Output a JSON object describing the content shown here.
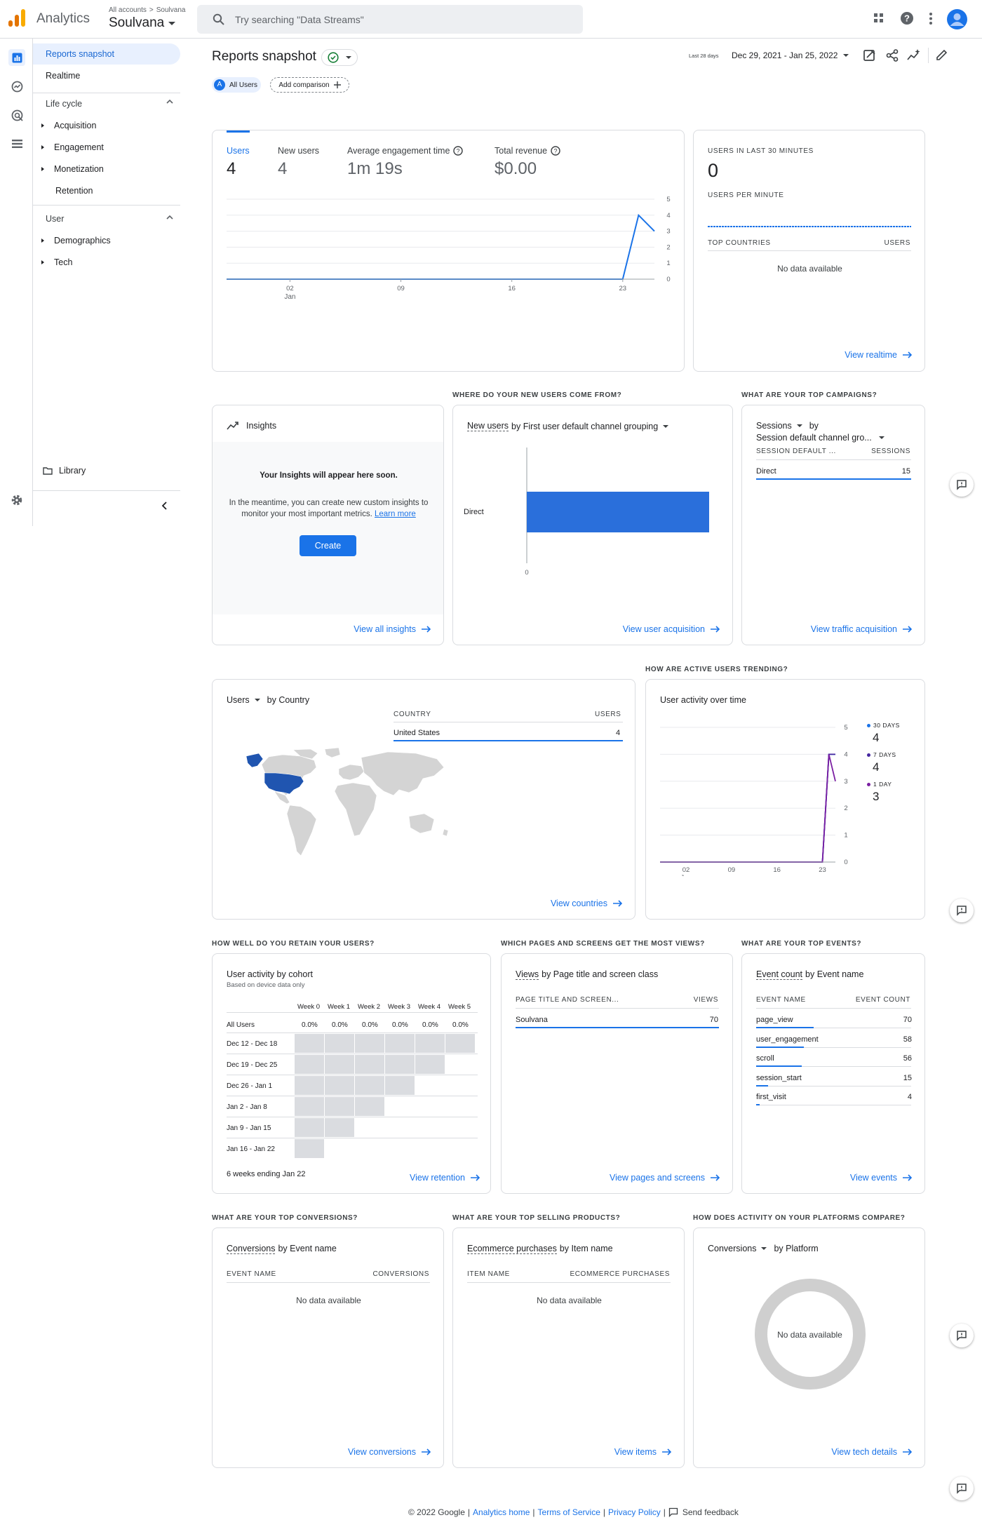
{
  "app": {
    "name": "Analytics",
    "breadcrumb_all": "All accounts",
    "breadcrumb_sep": ">",
    "breadcrumb_account": "Soulvana",
    "property": "Soulvana"
  },
  "search": {
    "placeholder": "Try searching \"Data Streams\""
  },
  "nav": {
    "items": [
      {
        "label": "Reports snapshot"
      },
      {
        "label": "Realtime"
      }
    ],
    "lifecycle": {
      "title": "Life cycle",
      "items": [
        "Acquisition",
        "Engagement",
        "Monetization",
        "Retention"
      ]
    },
    "user": {
      "title": "User",
      "items": [
        "Demographics",
        "Tech"
      ]
    },
    "library": "Library"
  },
  "header": {
    "title": "Reports snapshot",
    "date_label": "Last 28 days",
    "date_range": "Dec 29, 2021 - Jan 25, 2022",
    "all_users_badge": "A",
    "all_users": "All Users",
    "add_comparison": "Add comparison"
  },
  "overview": {
    "metrics": [
      {
        "label": "Users",
        "value": "4"
      },
      {
        "label": "New users",
        "value": "4"
      },
      {
        "label": "Average engagement time",
        "value": "1m 19s"
      },
      {
        "label": "Total revenue",
        "value": "$0.00"
      }
    ],
    "y_ticks": [
      "5",
      "4",
      "3",
      "2",
      "1",
      "0"
    ],
    "x_ticks": [
      "02",
      "09",
      "16",
      "23"
    ],
    "x_sub": "Jan"
  },
  "realtime": {
    "title": "USERS IN LAST 30 MINUTES",
    "value": "0",
    "per_minute": "USERS PER MINUTE",
    "col1": "TOP COUNTRIES",
    "col2": "USERS",
    "nodata": "No data available",
    "link": "View realtime"
  },
  "insights": {
    "title": "Insights",
    "heading": "Your Insights will appear here soon.",
    "body": "In the meantime, you can create new custom insights to monitor your most important metrics.",
    "learn_more": "Learn more",
    "button": "Create",
    "link": "View all insights"
  },
  "acquisition": {
    "section": "WHERE DO YOUR NEW USERS COME FROM?",
    "metric": "New users",
    "by": "by First user default channel grouping",
    "bar_label": "Direct",
    "x_tick": "0",
    "link": "View user acquisition"
  },
  "campaigns": {
    "section": "WHAT ARE YOUR TOP CAMPAIGNS?",
    "metric": "Sessions",
    "by": "by",
    "dimension": "Session default channel gro...",
    "col1": "SESSION DEFAULT ...",
    "col2": "SESSIONS",
    "rows": [
      {
        "name": "Direct",
        "value": "15"
      }
    ],
    "link": "View traffic acquisition"
  },
  "country": {
    "metric": "Users",
    "by": "by Country",
    "col1": "COUNTRY",
    "col2": "USERS",
    "rows": [
      {
        "name": "United States",
        "value": "4"
      }
    ],
    "link": "View countries"
  },
  "trend": {
    "section": "HOW ARE ACTIVE USERS TRENDING?",
    "title": "User activity over time",
    "y_ticks": [
      "5",
      "4",
      "3",
      "2",
      "1",
      "0"
    ],
    "x_ticks": [
      "02",
      "09",
      "16",
      "23"
    ],
    "x_sub": "Jan",
    "legend": [
      {
        "label": "30 DAYS",
        "value": "4",
        "color": "#1a73e8"
      },
      {
        "label": "7 DAYS",
        "value": "4",
        "color": "#4527a0"
      },
      {
        "label": "1 DAY",
        "value": "3",
        "color": "#7b1fa2"
      }
    ]
  },
  "retention": {
    "section": "HOW WELL DO YOU RETAIN YOUR USERS?",
    "title": "User activity by cohort",
    "subtitle": "Based on device data only",
    "weeks": [
      "Week 0",
      "Week 1",
      "Week 2",
      "Week 3",
      "Week 4",
      "Week 5"
    ],
    "all_users": "All Users",
    "all_values": [
      "0.0%",
      "0.0%",
      "0.0%",
      "0.0%",
      "0.0%",
      "0.0%"
    ],
    "cohorts": [
      "Dec 12 - Dec 18",
      "Dec 19 - Dec 25",
      "Dec 26 - Jan 1",
      "Jan 2 - Jan 8",
      "Jan 9 - Jan 15",
      "Jan 16 - Jan 22"
    ],
    "footer": "6 weeks ending Jan 22",
    "link": "View retention"
  },
  "pages": {
    "section": "WHICH PAGES AND SCREENS GET THE MOST VIEWS?",
    "metric": "Views",
    "by": "by Page title and screen class",
    "col1": "PAGE TITLE AND SCREEN...",
    "col2": "VIEWS",
    "rows": [
      {
        "name": "Soulvana",
        "value": "70"
      }
    ],
    "link": "View pages and screens"
  },
  "events": {
    "section": "WHAT ARE YOUR TOP EVENTS?",
    "metric": "Event count",
    "by": "by Event name",
    "col1": "EVENT NAME",
    "col2": "EVENT COUNT",
    "rows": [
      {
        "name": "page_view",
        "value": "70",
        "share": 1.0
      },
      {
        "name": "user_engagement",
        "value": "58",
        "share": 0.83
      },
      {
        "name": "scroll",
        "value": "56",
        "share": 0.8
      },
      {
        "name": "session_start",
        "value": "15",
        "share": 0.21
      },
      {
        "name": "first_visit",
        "value": "4",
        "share": 0.06
      }
    ],
    "link": "View events"
  },
  "conversions": {
    "section": "WHAT ARE YOUR TOP CONVERSIONS?",
    "metric": "Conversions",
    "by": "by Event name",
    "col1": "EVENT NAME",
    "col2": "CONVERSIONS",
    "nodata": "No data available",
    "link": "View conversions"
  },
  "products": {
    "section": "WHAT ARE YOUR TOP SELLING PRODUCTS?",
    "metric": "Ecommerce purchases",
    "by": "by Item name",
    "col1": "ITEM NAME",
    "col2": "ECOMMERCE PURCHASES",
    "nodata": "No data available",
    "link": "View items"
  },
  "platforms": {
    "section": "HOW DOES ACTIVITY ON YOUR PLATFORMS COMPARE?",
    "metric": "Conversions",
    "by": "by Platform",
    "nodata": "No data available",
    "link": "View tech details"
  },
  "footer": {
    "copyright": "© 2022 Google",
    "home": "Analytics home",
    "tos": "Terms of Service",
    "privacy": "Privacy Policy",
    "feedback": "Send feedback",
    "sep": "|"
  },
  "chart_data": [
    {
      "type": "line",
      "title": "Users",
      "x": [
        "Dec 29",
        "Dec 30",
        "Dec 31",
        "Jan 01",
        "Jan 02",
        "Jan 03",
        "Jan 04",
        "Jan 05",
        "Jan 06",
        "Jan 07",
        "Jan 08",
        "Jan 09",
        "Jan 10",
        "Jan 11",
        "Jan 12",
        "Jan 13",
        "Jan 14",
        "Jan 15",
        "Jan 16",
        "Jan 17",
        "Jan 18",
        "Jan 19",
        "Jan 20",
        "Jan 21",
        "Jan 22",
        "Jan 23",
        "Jan 24",
        "Jan 25"
      ],
      "series": [
        {
          "values": [
            0,
            0,
            0,
            0,
            0,
            0,
            0,
            0,
            0,
            0,
            0,
            0,
            0,
            0,
            0,
            0,
            0,
            0,
            0,
            0,
            0,
            0,
            0,
            0,
            0,
            0,
            4,
            3
          ]
        }
      ],
      "ylim": [
        0,
        5
      ]
    },
    {
      "type": "bar",
      "orientation": "horizontal",
      "categories": [
        "Direct"
      ],
      "values": [
        4
      ]
    },
    {
      "type": "line",
      "title": "User activity over time",
      "x": [
        "Dec 29",
        "Dec 30",
        "Dec 31",
        "Jan 01",
        "Jan 02",
        "Jan 03",
        "Jan 04",
        "Jan 05",
        "Jan 06",
        "Jan 07",
        "Jan 08",
        "Jan 09",
        "Jan 10",
        "Jan 11",
        "Jan 12",
        "Jan 13",
        "Jan 14",
        "Jan 15",
        "Jan 16",
        "Jan 17",
        "Jan 18",
        "Jan 19",
        "Jan 20",
        "Jan 21",
        "Jan 22",
        "Jan 23",
        "Jan 24",
        "Jan 25"
      ],
      "series": [
        {
          "name": "30 DAYS",
          "values": [
            0,
            0,
            0,
            0,
            0,
            0,
            0,
            0,
            0,
            0,
            0,
            0,
            0,
            0,
            0,
            0,
            0,
            0,
            0,
            0,
            0,
            0,
            0,
            0,
            0,
            0,
            4,
            4
          ]
        },
        {
          "name": "7 DAYS",
          "values": [
            0,
            0,
            0,
            0,
            0,
            0,
            0,
            0,
            0,
            0,
            0,
            0,
            0,
            0,
            0,
            0,
            0,
            0,
            0,
            0,
            0,
            0,
            0,
            0,
            0,
            0,
            4,
            4
          ]
        },
        {
          "name": "1 DAY",
          "values": [
            0,
            0,
            0,
            0,
            0,
            0,
            0,
            0,
            0,
            0,
            0,
            0,
            0,
            0,
            0,
            0,
            0,
            0,
            0,
            0,
            0,
            0,
            0,
            0,
            0,
            0,
            4,
            3
          ]
        }
      ],
      "ylim": [
        0,
        5
      ]
    }
  ]
}
